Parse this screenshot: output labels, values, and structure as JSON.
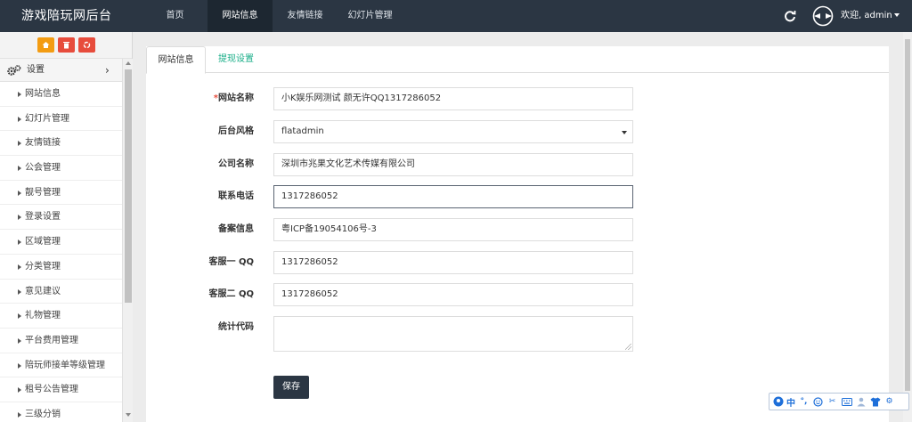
{
  "app": {
    "title": "游戏陪玩网后台"
  },
  "topnav": [
    {
      "label": "首页",
      "active": false
    },
    {
      "label": "网站信息",
      "active": true
    },
    {
      "label": "友情链接",
      "active": false
    },
    {
      "label": "幻灯片管理",
      "active": false
    }
  ],
  "header": {
    "refresh_icon": "refresh-icon",
    "user_icon": "user-avatar-icon",
    "welcome": "欢迎, admin"
  },
  "sidebar": {
    "tools": [
      {
        "icon": "home-icon",
        "color": "#f39c12"
      },
      {
        "icon": "trash-icon",
        "color": "#e74c3c"
      },
      {
        "icon": "recycle-icon",
        "color": "#e74c3c"
      }
    ],
    "section": {
      "label": "设置",
      "icon": "gears-icon"
    },
    "items": [
      {
        "label": "网站信息"
      },
      {
        "label": "幻灯片管理"
      },
      {
        "label": "友情链接"
      },
      {
        "label": "公会管理"
      },
      {
        "label": "靓号管理"
      },
      {
        "label": "登录设置"
      },
      {
        "label": "区域管理"
      },
      {
        "label": "分类管理"
      },
      {
        "label": "意见建议"
      },
      {
        "label": "礼物管理"
      },
      {
        "label": "平台费用管理"
      },
      {
        "label": "陪玩师接单等级管理"
      },
      {
        "label": "租号公告管理"
      },
      {
        "label": "三级分销"
      }
    ]
  },
  "tabs": [
    {
      "label": "网站信息",
      "active": true
    },
    {
      "label": "提现设置",
      "active": false
    }
  ],
  "form": {
    "site_name": {
      "label": "网站名称",
      "required_mark": "*",
      "value": "小K娱乐网测试 颜无许QQ1317286052"
    },
    "theme": {
      "label": "后台风格",
      "value": "flatadmin"
    },
    "company": {
      "label": "公司名称",
      "value": "深圳市兆果文化艺术传媒有限公司"
    },
    "phone": {
      "label": "联系电话",
      "value": "1317286052"
    },
    "icp": {
      "label": "备案信息",
      "value": "粤ICP备19054106号-3"
    },
    "qq1": {
      "label": "客服一 QQ",
      "value": "1317286052"
    },
    "qq2": {
      "label": "客服二 QQ",
      "value": "1317286052"
    },
    "stats": {
      "label": "统计代码",
      "value": ""
    },
    "save_label": "保存"
  },
  "ime": {
    "zh_label": "中"
  },
  "colors": {
    "topbar": "#2b3643",
    "accent_green": "#1aae88",
    "required": "#e74c3c"
  }
}
